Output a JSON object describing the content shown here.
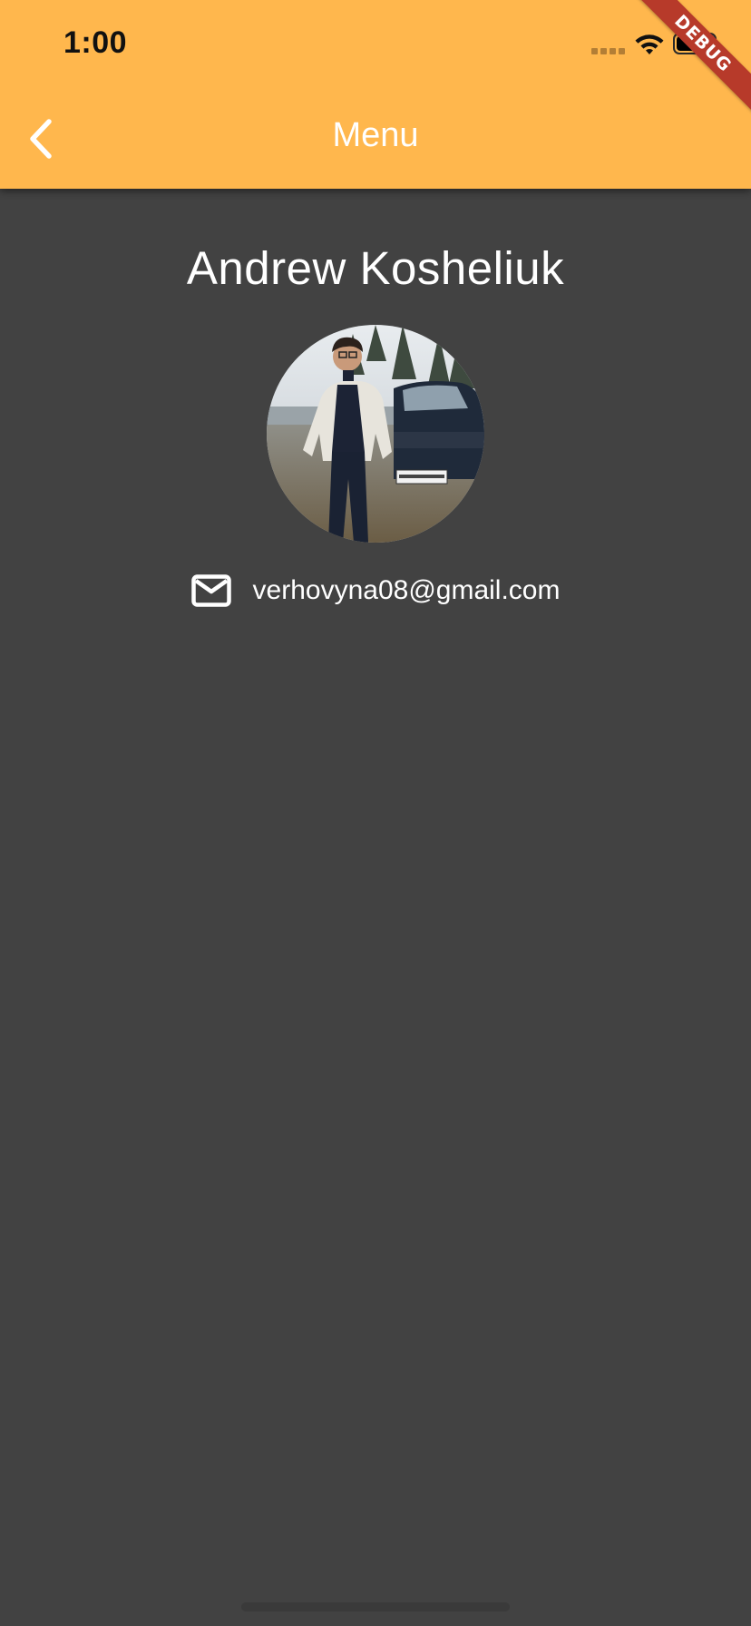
{
  "status_bar": {
    "time": "1:00"
  },
  "debug_banner": {
    "label": "DEBUG"
  },
  "app_bar": {
    "title": "Menu",
    "back_icon": "chevron-left-icon",
    "background_color": "#FFB74D"
  },
  "profile": {
    "name": "Andrew Kosheliuk",
    "email": "verhovyna08@gmail.com",
    "email_icon": "mail-icon"
  },
  "theme": {
    "page_background": "#424242",
    "text_color": "#FFFFFF",
    "debug_color": "#B73A2A"
  }
}
